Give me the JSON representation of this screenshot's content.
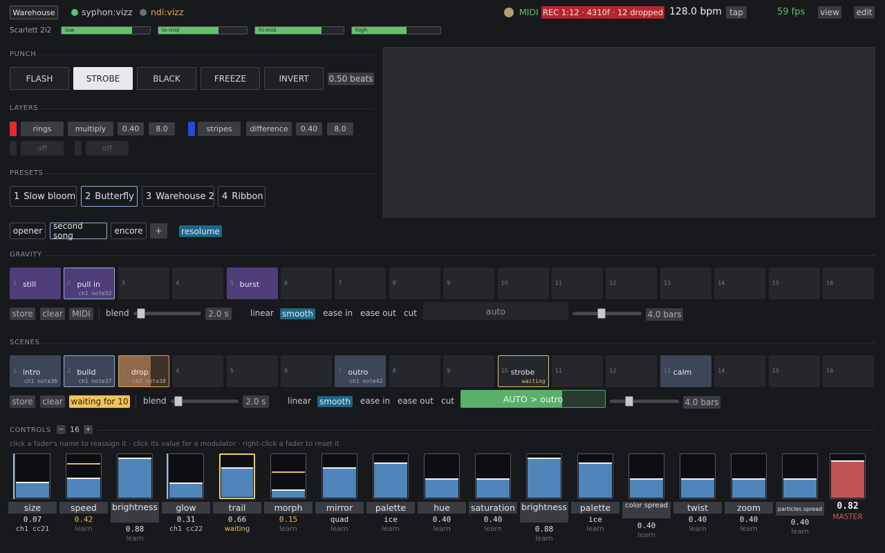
{
  "topbar": {
    "venue": "Warehouse",
    "outputs": [
      {
        "label": "syphon:vizz",
        "color": "#5ec26b"
      },
      {
        "label": "ndi:vizz",
        "color": "#6c6f75"
      }
    ],
    "midi": "MIDI",
    "rec": "REC 1:12 · 4310f · 12 dropped",
    "bpm": "128.0 bpm",
    "tap": "tap",
    "fps": "59 fps",
    "view": "view",
    "edit": "edit"
  },
  "audio": {
    "device": "Scarlett 2i2",
    "bands": [
      {
        "label": "low",
        "level": 0.8
      },
      {
        "label": "lo-mid",
        "level": 0.68
      },
      {
        "label": "hi-mid",
        "level": 0.75
      },
      {
        "label": "high",
        "level": 0.62
      }
    ]
  },
  "punch": {
    "title": "PUNCH",
    "buttons": [
      "FLASH",
      "STROBE",
      "BLACK",
      "FREEZE",
      "INVERT"
    ],
    "active": "STROBE",
    "beats": "0.50 beats"
  },
  "layers": {
    "title": "LAYERS",
    "rows": [
      {
        "color": "#e5282e",
        "name": "rings",
        "blend": "multiply",
        "a": "0.40",
        "b": "8.0"
      },
      {
        "color": "#2448e2",
        "name": "stripes",
        "blend": "difference",
        "a": "0.40",
        "b": "8.0"
      }
    ],
    "off": [
      "off",
      "off"
    ]
  },
  "presets": {
    "title": "PRESETS",
    "items": [
      {
        "num": "1",
        "name": "Slow bloom"
      },
      {
        "num": "2",
        "name": "Butterfly"
      },
      {
        "num": "3",
        "name": "Warehouse 2"
      },
      {
        "num": "4",
        "name": "Ribbon"
      }
    ],
    "active_index": 1
  },
  "setlist": {
    "items": [
      "opener",
      "second song",
      "encore"
    ],
    "add": "+",
    "active": "second song",
    "target": "resolume"
  },
  "gravity": {
    "title": "GRAVITY",
    "pads": [
      {
        "n": "1",
        "name": "still",
        "map": "",
        "style": "purple"
      },
      {
        "n": "2",
        "name": "pull in",
        "map": "ch1 note52",
        "style": "purple sel"
      },
      {
        "n": "3",
        "name": "",
        "map": "",
        "style": ""
      },
      {
        "n": "4",
        "name": "",
        "map": "",
        "style": ""
      },
      {
        "n": "5",
        "name": "burst",
        "map": "",
        "style": "purple"
      },
      {
        "n": "6",
        "name": "",
        "map": "",
        "style": ""
      },
      {
        "n": "7",
        "name": "",
        "map": "",
        "style": ""
      },
      {
        "n": "8",
        "name": "",
        "map": "",
        "style": ""
      },
      {
        "n": "9",
        "name": "",
        "map": "",
        "style": ""
      },
      {
        "n": "10",
        "name": "",
        "map": "",
        "style": ""
      },
      {
        "n": "11",
        "name": "",
        "map": "",
        "style": ""
      },
      {
        "n": "12",
        "name": "",
        "map": "",
        "style": ""
      },
      {
        "n": "13",
        "name": "",
        "map": "",
        "style": ""
      },
      {
        "n": "14",
        "name": "",
        "map": "",
        "style": ""
      },
      {
        "n": "15",
        "name": "",
        "map": "",
        "style": ""
      },
      {
        "n": "16",
        "name": "",
        "map": "",
        "style": ""
      }
    ],
    "store": "store",
    "clear": "clear",
    "midi": "MIDI",
    "blend_label": "blend",
    "blend_value": "2.0 s",
    "blend_pos": 0.05,
    "curves": [
      "linear",
      "smooth",
      "ease in",
      "ease out",
      "cut"
    ],
    "curve_active": "smooth",
    "auto": "auto",
    "bars_pos": 0.25,
    "bars": "4.0 bars"
  },
  "scenes": {
    "title": "SCENES",
    "pads": [
      {
        "n": "1",
        "name": "intro",
        "map": "ch1 note36",
        "style": "slate"
      },
      {
        "n": "2",
        "name": "build",
        "map": "ch1 note37",
        "style": "slate sel"
      },
      {
        "n": "3",
        "name": "drop",
        "map": "ch1 note38",
        "style": "drop"
      },
      {
        "n": "4",
        "name": "",
        "map": "",
        "style": ""
      },
      {
        "n": "5",
        "name": "",
        "map": "",
        "style": ""
      },
      {
        "n": "6",
        "name": "",
        "map": "",
        "style": ""
      },
      {
        "n": "7",
        "name": "outro",
        "map": "ch1 note42",
        "style": "slate"
      },
      {
        "n": "8",
        "name": "",
        "map": "",
        "style": ""
      },
      {
        "n": "9",
        "name": "",
        "map": "",
        "style": ""
      },
      {
        "n": "10",
        "name": "strobe",
        "map": "waiting",
        "style": "wait"
      },
      {
        "n": "11",
        "name": "",
        "map": "",
        "style": ""
      },
      {
        "n": "12",
        "name": "",
        "map": "",
        "style": ""
      },
      {
        "n": "13",
        "name": "calm",
        "map": "",
        "style": "slate"
      },
      {
        "n": "14",
        "name": "",
        "map": "",
        "style": ""
      },
      {
        "n": "15",
        "name": "",
        "map": "",
        "style": ""
      },
      {
        "n": "16",
        "name": "",
        "map": "",
        "style": ""
      }
    ],
    "store": "store",
    "clear": "clear",
    "waiting": "waiting for 10",
    "blend_label": "blend",
    "blend_value": "2.0 s",
    "blend_pos": 0.05,
    "curves": [
      "linear",
      "smooth",
      "ease in",
      "ease out",
      "cut"
    ],
    "curve_active": "smooth",
    "auto": "AUTO > outro",
    "auto_progress": 0.7,
    "bars_pos": 0.05,
    "bars": "4.0 bars"
  },
  "controls": {
    "title": "CONTROLS",
    "minus": "−",
    "count": "16",
    "plus": "+",
    "hint": "click a fader's name to reassign it · click its value for a modulator · right-click a fader to reset it",
    "faders": [
      {
        "name": "size",
        "value": "0.07",
        "sub": "ch1 cc21",
        "level": 0.33,
        "kind": "midi"
      },
      {
        "name": "speed",
        "value": "0.42",
        "sub": "learn",
        "level": 0.42,
        "kind": "mod",
        "mod": 0.77
      },
      {
        "name": "brightness",
        "value": "0.88",
        "sub": "learn",
        "level": 0.88,
        "kind": "wrap"
      },
      {
        "name": "glow",
        "value": "0.31",
        "sub": "ch1 cc22",
        "level": 0.31,
        "kind": "midi"
      },
      {
        "name": "trail",
        "value": "0.66",
        "sub": "waiting",
        "level": 0.66,
        "kind": "hl"
      },
      {
        "name": "morph",
        "value": "0.15",
        "sub": "learn",
        "level": 0.15,
        "kind": "mod",
        "mod": 0.58
      },
      {
        "name": "mirror",
        "value": "quad",
        "sub": "learn",
        "level": 0.66,
        "kind": ""
      },
      {
        "name": "palette",
        "value": "ice",
        "sub": "learn",
        "level": 0.77,
        "kind": ""
      },
      {
        "name": "hue",
        "value": "0.40",
        "sub": "learn",
        "level": 0.4,
        "kind": ""
      },
      {
        "name": "saturation",
        "value": "0.40",
        "sub": "learn",
        "level": 0.4,
        "kind": ""
      },
      {
        "name": "brightness",
        "value": "0.88",
        "sub": "learn",
        "level": 0.88,
        "kind": "wrap"
      },
      {
        "name": "palette",
        "value": "ice",
        "sub": "learn",
        "level": 0.77,
        "kind": ""
      },
      {
        "name": "color spread",
        "value": "0.40",
        "sub": "learn",
        "level": 0.4,
        "kind": "small"
      },
      {
        "name": "twist",
        "value": "0.40",
        "sub": "learn",
        "level": 0.4,
        "kind": ""
      },
      {
        "name": "zoom",
        "value": "0.40",
        "sub": "learn",
        "level": 0.4,
        "kind": ""
      },
      {
        "name": "particles spread",
        "value": "0.40",
        "sub": "learn",
        "level": 0.4,
        "kind": "tiny"
      }
    ],
    "master": {
      "value": "0.82",
      "label": "MASTER",
      "level": 0.82
    }
  }
}
